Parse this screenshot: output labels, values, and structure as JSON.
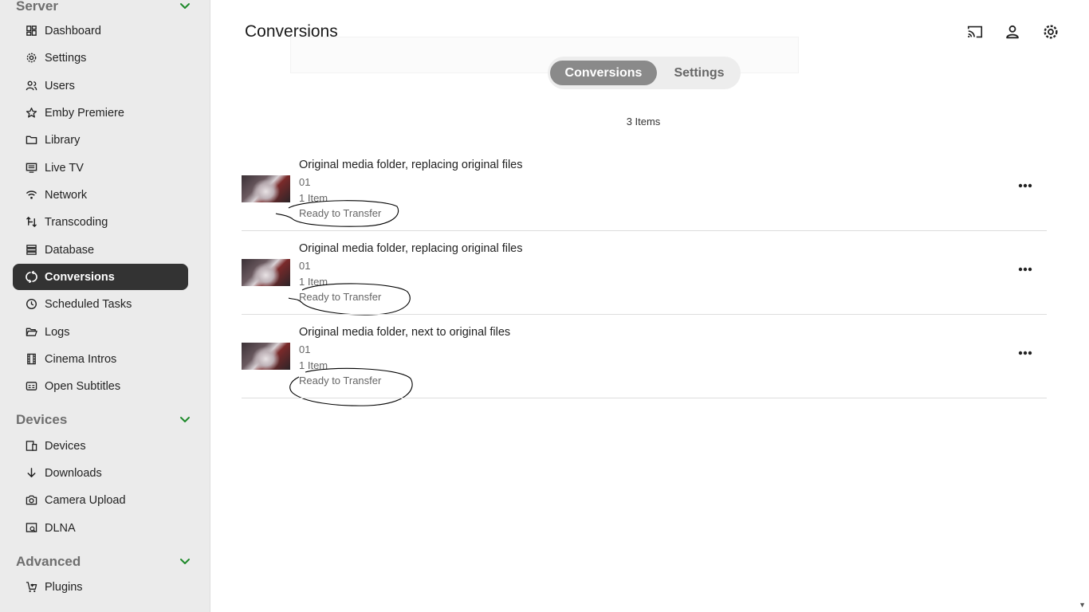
{
  "sidebar": {
    "sections": [
      {
        "title": "Server"
      },
      {
        "title": "Devices"
      },
      {
        "title": "Advanced"
      }
    ],
    "items": [
      {
        "label": "Dashboard",
        "icon": "dashboard-icon"
      },
      {
        "label": "Settings",
        "icon": "gear-icon"
      },
      {
        "label": "Users",
        "icon": "users-icon"
      },
      {
        "label": "Emby Premiere",
        "icon": "star-icon"
      },
      {
        "label": "Library",
        "icon": "folder-icon"
      },
      {
        "label": "Live TV",
        "icon": "tv-icon"
      },
      {
        "label": "Network",
        "icon": "wifi-icon"
      },
      {
        "label": "Transcoding",
        "icon": "transcode-icon"
      },
      {
        "label": "Database",
        "icon": "database-icon"
      },
      {
        "label": "Conversions",
        "icon": "conversions-icon",
        "active": true
      },
      {
        "label": "Scheduled Tasks",
        "icon": "clock-icon"
      },
      {
        "label": "Logs",
        "icon": "folder-open-icon"
      },
      {
        "label": "Cinema Intros",
        "icon": "film-icon"
      },
      {
        "label": "Open Subtitles",
        "icon": "subtitles-icon"
      },
      {
        "label": "Devices",
        "icon": "devices-icon"
      },
      {
        "label": "Downloads",
        "icon": "download-icon"
      },
      {
        "label": "Camera Upload",
        "icon": "camera-icon"
      },
      {
        "label": "DLNA",
        "icon": "dlna-icon"
      },
      {
        "label": "Plugins",
        "icon": "cart-icon"
      }
    ]
  },
  "header": {
    "title": "Conversions",
    "icons": [
      "cast-icon",
      "user-icon",
      "gear-icon"
    ]
  },
  "tabs": [
    {
      "label": "Conversions",
      "active": true
    },
    {
      "label": "Settings",
      "active": false
    }
  ],
  "items_count": "3 Items",
  "rows": [
    {
      "title": "Original media folder, replacing original files",
      "episode": "01",
      "count": "1 Item",
      "status": "Ready to Transfer"
    },
    {
      "title": "Original media folder, replacing original files",
      "episode": "01",
      "count": "1 Item",
      "status": "Ready to Transfer"
    },
    {
      "title": "Original media folder, next to original files",
      "episode": "01",
      "count": "1 Item",
      "status": "Ready to Transfer"
    }
  ],
  "colors": {
    "sidebar_bg": "#ebebeb",
    "active_item_bg": "#333333",
    "chevron_green": "#1e8a2a",
    "tab_active_bg": "#8a8a8a"
  }
}
